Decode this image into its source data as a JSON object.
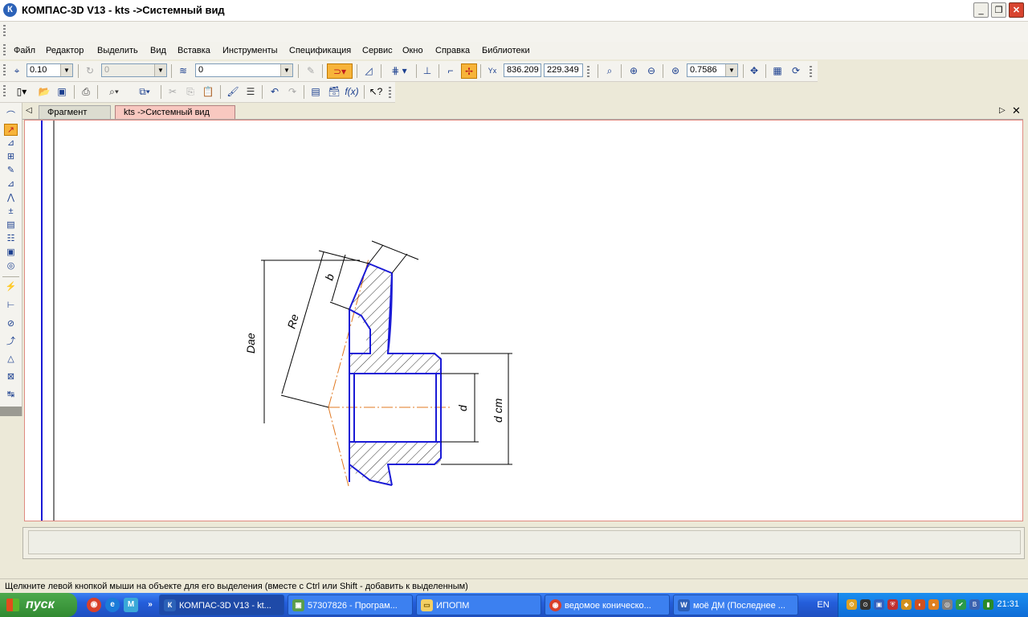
{
  "window": {
    "app_icon": "kompas-icon",
    "title": "КОМПАС-3D V13 - kts ->Системный вид",
    "buttons": {
      "minimize": "_",
      "restore": "❐",
      "close": "✕"
    }
  },
  "menu": [
    "Файл",
    "Редактор",
    "Выделить",
    "Вид",
    "Вставка",
    "Инструменты",
    "Спецификация",
    "Сервис",
    "Окно",
    "Справка",
    "Библиотеки"
  ],
  "toolbar_current": {
    "step_value": "0.10",
    "angle_value": "0",
    "layer_value": "0",
    "coord_x": "836.209",
    "coord_y": "229.349",
    "coord_label": "Yx"
  },
  "toolbar_view": {
    "zoom_value": "0.7586"
  },
  "tabs": [
    {
      "label": "Фрагмент"
    },
    {
      "label": "kts ->Системный вид"
    }
  ],
  "drawing": {
    "labels": {
      "b": "b",
      "re": "Re",
      "dae": "Dae",
      "d": "d",
      "dst": "d ст"
    },
    "colors": {
      "contour": "#1a1ad6",
      "axis": "#e07820",
      "dimension": "#000000"
    }
  },
  "status": {
    "hint": "Щелкните левой кнопкой мыши на объекте для его выделения (вместе с Ctrl или Shift - добавить к выделенным)"
  },
  "taskbar": {
    "start": "пуск",
    "tasks": [
      {
        "label": "КОМПАС-3D V13 - kt...",
        "icon": "kompas-icon"
      },
      {
        "label": "57307826 - Програм...",
        "icon": "image-icon"
      },
      {
        "label": "ИПОПМ",
        "icon": "folder-icon"
      },
      {
        "label": "ведомое коническо...",
        "icon": "chrome-icon"
      },
      {
        "label": "моё ДМ (Последнее ...",
        "icon": "word-icon"
      }
    ],
    "language": "EN",
    "time": "21:31"
  }
}
